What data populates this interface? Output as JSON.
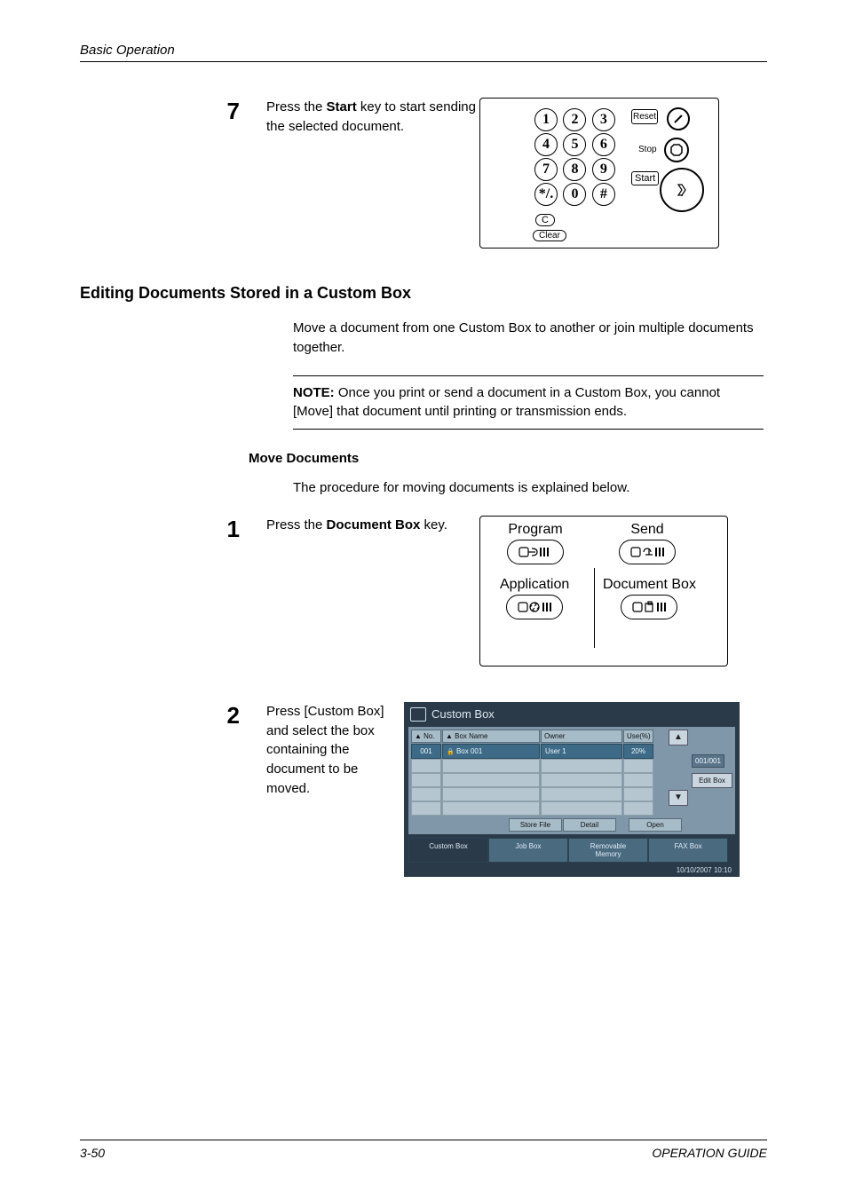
{
  "header": {
    "breadcrumb": "Basic Operation"
  },
  "step7": {
    "number": "7",
    "text_parts": [
      "Press the ",
      "Start",
      " key to start sending the selected document."
    ]
  },
  "keypad": {
    "keys": [
      "1",
      "2",
      "3",
      "4",
      "5",
      "6",
      "7",
      "8",
      "9",
      "*/.",
      "0",
      "#"
    ],
    "reset": "Reset",
    "stop": "Stop",
    "start": "Start",
    "c": "C",
    "clear": "Clear"
  },
  "section_heading": "Editing Documents Stored in a Custom Box",
  "section_body": "Move a document from one Custom Box to another or join multiple documents together.",
  "note": {
    "label": "NOTE:",
    "text": " Once you print or send a document in a Custom Box, you cannot [Move] that document until printing or transmission ends."
  },
  "move_docs": {
    "heading": "Move Documents",
    "intro": "The procedure for moving documents is explained below."
  },
  "step1": {
    "number": "1",
    "text_parts": [
      "Press the ",
      "Document Box",
      " key."
    ]
  },
  "panel2": {
    "program": "Program",
    "send": "Send",
    "application": "Application",
    "document_box": "Document Box"
  },
  "step2": {
    "number": "2",
    "text": "Press [Custom Box] and select the box containing the document to be moved."
  },
  "touchscreen": {
    "title": "Custom Box",
    "cols": {
      "no": "No.",
      "box_name": "Box Name",
      "owner": "Owner",
      "use": "Use(%)"
    },
    "row": {
      "no": "001",
      "box_name": "Box 001",
      "owner": "User 1",
      "use": "20%"
    },
    "page": "001/001",
    "edit_box": "Edit Box",
    "store_file": "Store File",
    "detail": "Detail",
    "open": "Open",
    "tabs": {
      "custom": "Custom Box",
      "job": "Job Box",
      "removable": "Removable\nMemory",
      "fax": "FAX Box"
    },
    "timestamp": "10/10/2007   10:10"
  },
  "footer": {
    "left": "3-50",
    "right": "OPERATION GUIDE"
  }
}
